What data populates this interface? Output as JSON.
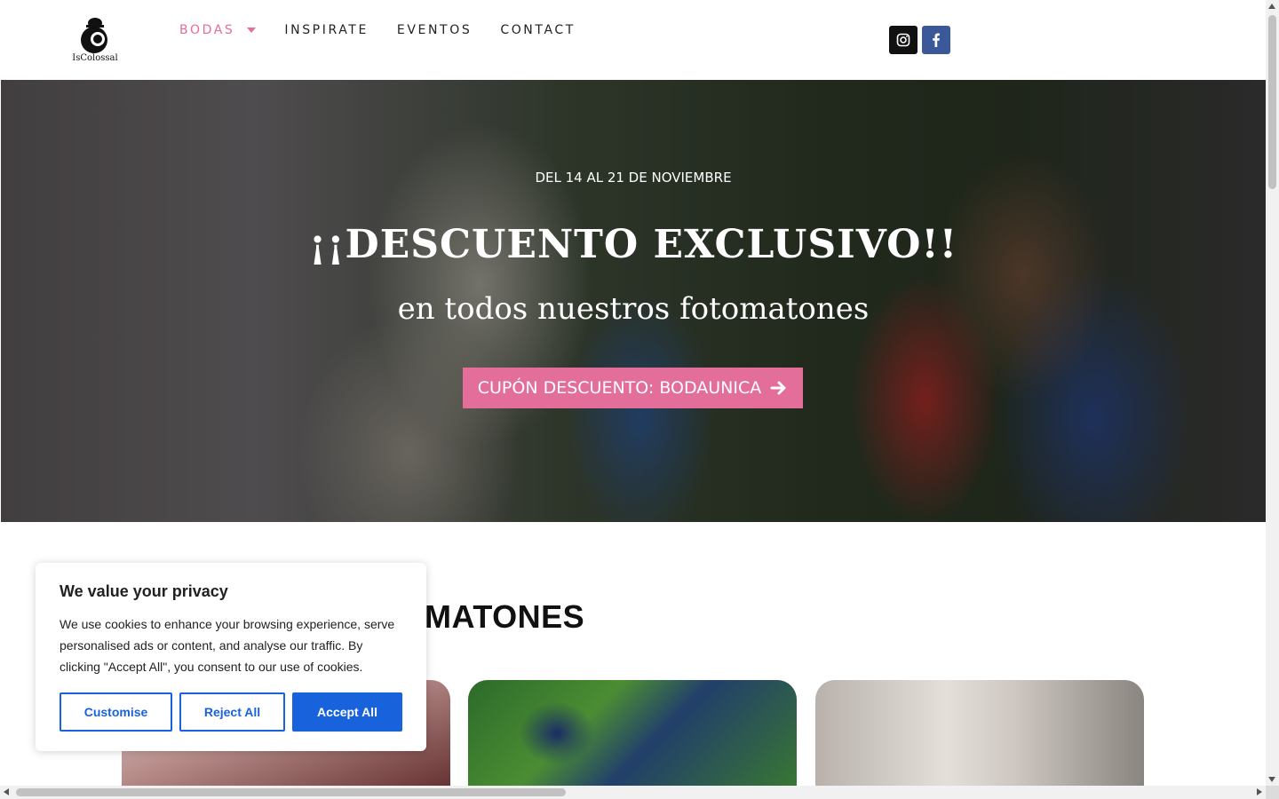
{
  "brand": {
    "name": "IsColossal",
    "logo_icon": "camera-bowler-hat-logo"
  },
  "nav": {
    "items": [
      {
        "label": "BODAS",
        "active": true,
        "has_dropdown": true
      },
      {
        "label": "INSPIRATE",
        "active": false
      },
      {
        "label": "EVENTOS",
        "active": false
      },
      {
        "label": "CONTACT",
        "active": false
      }
    ]
  },
  "social": {
    "instagram_icon": "instagram-icon",
    "facebook_icon": "facebook-icon",
    "instagram_bg": "#111111",
    "facebook_bg": "#3b5998"
  },
  "hero": {
    "dates": "DEL 14 AL 21 DE NOVIEMBRE",
    "title": "¡¡DESCUENTO EXCLUSIVO!!",
    "subtitle": "en todos nuestros fotomatones",
    "button_label": "CUPÓN DESCUENTO: BODAUNICA",
    "button_icon": "arrow-right-icon",
    "accent": "#e46e9a"
  },
  "section": {
    "title_visible": "MATONES"
  },
  "cookie": {
    "title": "We value your privacy",
    "text": "We use cookies to enhance your browsing experience, serve personalised ads or content, and analyse our traffic. By clicking \"Accept All\", you consent to our use of cookies.",
    "customise_label": "Customise",
    "reject_label": "Reject All",
    "accept_label": "Accept All",
    "accent": "#1863dc"
  }
}
